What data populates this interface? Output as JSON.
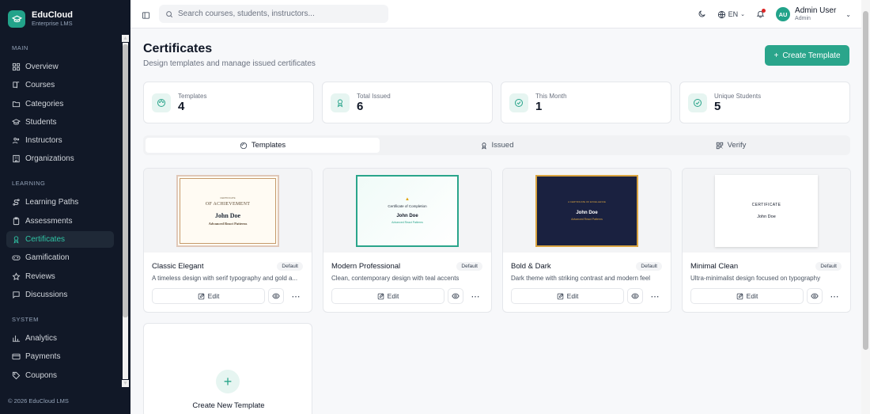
{
  "brand": {
    "name": "EduCloud",
    "sub": "Enterprise LMS"
  },
  "sidebar": {
    "sections": [
      {
        "label": "MAIN",
        "items": [
          {
            "label": "Overview",
            "icon": "grid-icon"
          },
          {
            "label": "Courses",
            "icon": "book-icon"
          },
          {
            "label": "Categories",
            "icon": "folder-icon"
          },
          {
            "label": "Students",
            "icon": "graduation-cap-icon"
          },
          {
            "label": "Instructors",
            "icon": "users-icon"
          },
          {
            "label": "Organizations",
            "icon": "building-icon"
          }
        ]
      },
      {
        "label": "LEARNING",
        "items": [
          {
            "label": "Learning Paths",
            "icon": "route-icon"
          },
          {
            "label": "Assessments",
            "icon": "clipboard-icon"
          },
          {
            "label": "Certificates",
            "icon": "award-icon",
            "active": true
          },
          {
            "label": "Gamification",
            "icon": "gamepad-icon"
          },
          {
            "label": "Reviews",
            "icon": "star-icon"
          },
          {
            "label": "Discussions",
            "icon": "message-icon"
          }
        ]
      },
      {
        "label": "SYSTEM",
        "items": [
          {
            "label": "Analytics",
            "icon": "chart-icon"
          },
          {
            "label": "Payments",
            "icon": "credit-card-icon"
          },
          {
            "label": "Coupons",
            "icon": "tag-icon"
          }
        ]
      }
    ],
    "footer": "© 2026 EduCloud LMS"
  },
  "topbar": {
    "search_placeholder": "Search courses, students, instructors...",
    "lang": "EN",
    "user_name": "Admin User",
    "user_role": "Admin",
    "avatar": "AU"
  },
  "page": {
    "title": "Certificates",
    "subtitle": "Design templates and manage issued certificates",
    "create_label": "Create Template"
  },
  "stats": [
    {
      "label": "Templates",
      "value": "4"
    },
    {
      "label": "Total Issued",
      "value": "6"
    },
    {
      "label": "This Month",
      "value": "1"
    },
    {
      "label": "Unique Students",
      "value": "5"
    }
  ],
  "tabs": [
    {
      "label": "Templates"
    },
    {
      "label": "Issued"
    },
    {
      "label": "Verify"
    }
  ],
  "templates": [
    {
      "name": "Classic Elegant",
      "badge": "Default",
      "desc": "A timeless design with serif typography and gold a...",
      "edit": "Edit",
      "cert": {
        "top": "CERTIFICATE",
        "title": "OF ACHIEVEMENT",
        "recipient": "John Doe",
        "course": "Advanced React Patterns"
      }
    },
    {
      "name": "Modern Professional",
      "badge": "Default",
      "desc": "Clean, contemporary design with teal accents",
      "edit": "Edit",
      "cert": {
        "title": "Certificate of Completion",
        "recipient": "John Doe",
        "course": "Advanced React Patterns"
      }
    },
    {
      "name": "Bold & Dark",
      "badge": "Default",
      "desc": "Dark theme with striking contrast and modern feel",
      "edit": "Edit",
      "cert": {
        "title": "A CERTIFICATE OF EXCELLENCE",
        "recipient": "John Doe",
        "course": "Advanced React Patterns"
      }
    },
    {
      "name": "Minimal Clean",
      "badge": "Default",
      "desc": "Ultra-minimalist design focused on typography",
      "edit": "Edit",
      "cert": {
        "title": "CERTIFICATE",
        "recipient": "John Doe"
      }
    }
  ],
  "new_template_label": "Create New Template",
  "colors": {
    "accent": "#2aa58b",
    "sidebar": "#111827"
  }
}
